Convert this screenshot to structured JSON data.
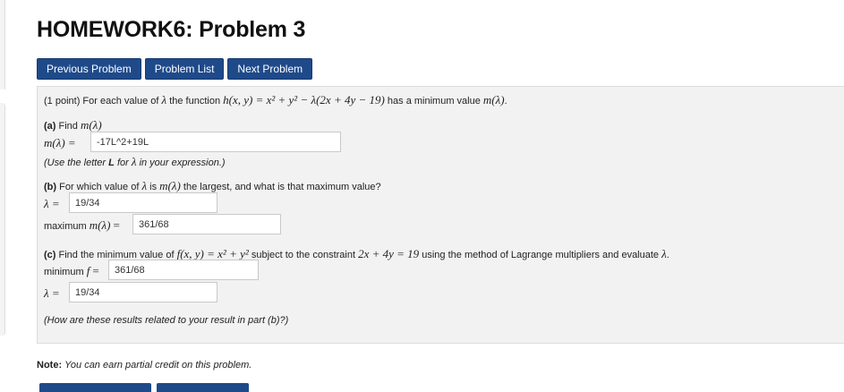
{
  "page": {
    "title": "HOMEWORK6: Problem 3"
  },
  "nav": {
    "previous": "Previous Problem",
    "list": "Problem List",
    "next": "Next Problem"
  },
  "problem": {
    "points": "(1 point)",
    "intro_pre": "For each value of",
    "intro_mid": "the function",
    "intro_post": "has a minimum value",
    "h_expr": "h(x, y) = x² + y² − λ(2x + 4y − 19)",
    "lambda": "λ",
    "m_lambda": "m(λ)",
    "part_a": {
      "label": "(a)",
      "find": "Find",
      "input_label": "m(λ) =",
      "value": "-17L^2+19L",
      "hint_pre": "(Use the letter",
      "hint_letter": "L",
      "hint_mid": "for",
      "hint_post": "in your expression.)"
    },
    "part_b": {
      "label": "(b)",
      "q_pre": "For which value of",
      "q_is": "is",
      "q_post": "the largest, and what is that maximum value?",
      "lambda_label": "λ =",
      "lambda_value": "19/34",
      "max_label": "maximum",
      "max_value": "361/68"
    },
    "part_c": {
      "label": "(c)",
      "q_pre": "Find the minimum value of",
      "f_expr": "f(x, y) = x² + y²",
      "q_mid": "subject to the constraint",
      "constraint": "2x + 4y = 19",
      "q_post": "using the method of Lagrange multipliers and evaluate",
      "min_label": "minimum",
      "f": "f",
      "min_value": "361/68",
      "lambda_label": "λ =",
      "lambda_value": "19/34",
      "relation": "(How are these results related to your result in part (b)?)"
    }
  },
  "note": {
    "label": "Note:",
    "text": "You can earn partial credit on this problem."
  },
  "colors": {
    "button_bg": "#1f4a8a",
    "panel_bg": "#f2f2f2"
  }
}
